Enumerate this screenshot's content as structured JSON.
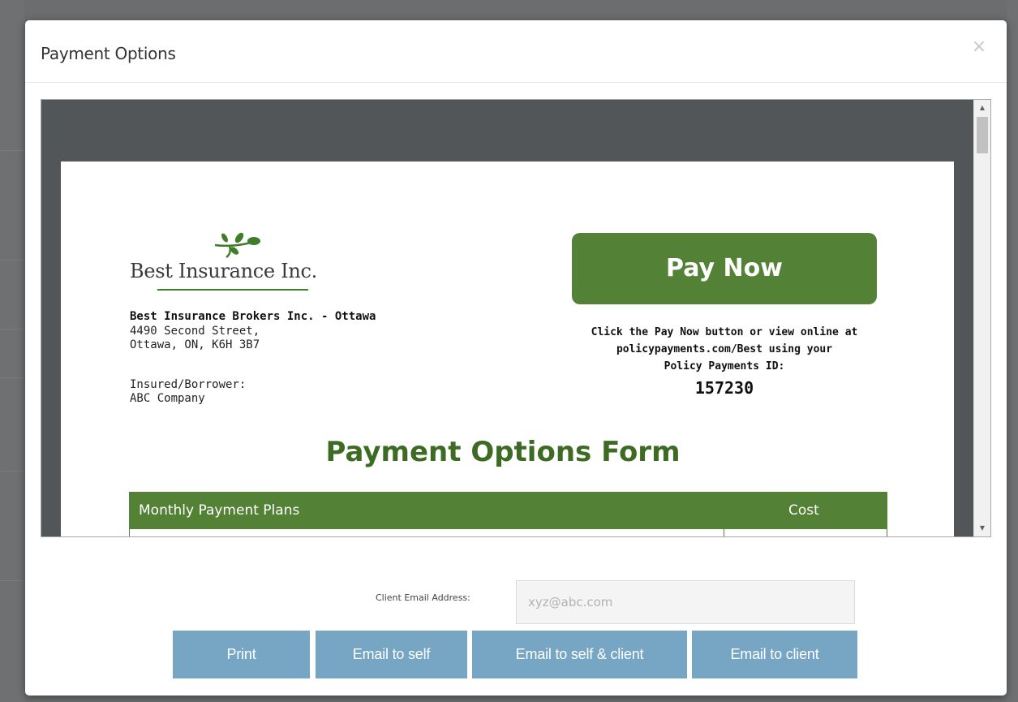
{
  "modal": {
    "title": "Payment Options",
    "close_glyph": "×"
  },
  "document": {
    "logo_text": "Best Insurance Inc.",
    "broker_name": "Best Insurance Brokers Inc. - Ottawa",
    "address_line1": "4490 Second Street,",
    "address_line2": "Ottawa, ON, K6H 3B7",
    "insured_label": "Insured/Borrower:",
    "insured_name": "ABC Company",
    "pay_now_label": "Pay Now",
    "pay_info_line1": "Click the Pay Now button or view online at",
    "pay_info_line2": "policypayments.com/Best using your",
    "pay_info_line3": "Policy Payments ID:",
    "policy_id": "157230",
    "form_title": "Payment Options Form",
    "table": {
      "col_plans": "Monthly Payment Plans",
      "col_cost": "Cost"
    }
  },
  "email": {
    "label": "Client Email Address:",
    "placeholder": "xyz@abc.com",
    "value": ""
  },
  "buttons": {
    "print": "Print",
    "email_self": "Email to self",
    "email_self_client": "Email to self & client",
    "email_client": "Email to client"
  },
  "colors": {
    "brand_green": "#538135",
    "title_green": "#3d6b23",
    "button_blue": "#77a6c4"
  },
  "icons": {
    "logo": "leaf-sprig-icon",
    "close": "close-icon",
    "scroll_up": "scroll-up-arrow-icon",
    "scroll_down": "scroll-down-arrow-icon"
  }
}
